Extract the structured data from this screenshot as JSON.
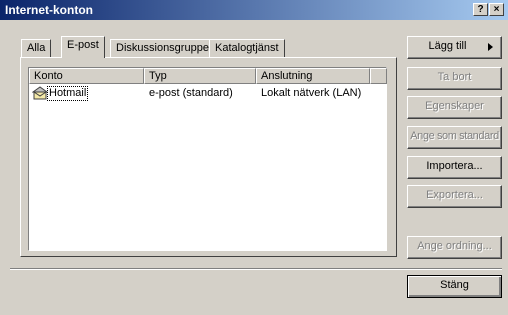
{
  "window": {
    "title": "Internet-konton",
    "help_label": "?",
    "close_label": "×"
  },
  "tabs": [
    {
      "label": "Alla"
    },
    {
      "label": "E-post"
    },
    {
      "label": "Diskussionsgrupper"
    },
    {
      "label": "Katalogtjänst"
    }
  ],
  "active_tab": "E-post",
  "list": {
    "columns": [
      "Konto",
      "Typ",
      "Anslutning"
    ],
    "rows": [
      {
        "account": "Hotmail",
        "type": "e-post (standard)",
        "connection": "Lokalt nätverk (LAN)"
      }
    ]
  },
  "buttons": {
    "add": "Lägg till",
    "remove": "Ta bort",
    "properties": "Egenskaper",
    "set_default": "Ange som standard",
    "import": "Importera...",
    "export": "Exportera...",
    "set_order": "Ange ordning...",
    "close": "Stäng"
  },
  "icons": {
    "account": "mail-account-icon"
  }
}
